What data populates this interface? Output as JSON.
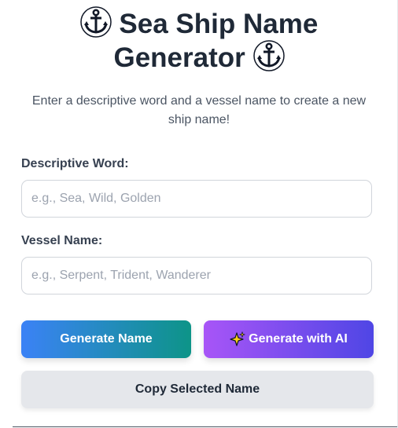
{
  "header": {
    "title_line1": "Sea Ship Name",
    "title_line2": "Generator",
    "title_icon": "anchor-icon",
    "subtitle": "Enter a descriptive word and a vessel name to create a new ship name!"
  },
  "form": {
    "descriptive_label": "Descriptive Word:",
    "descriptive_placeholder": "e.g., Sea, Wild, Golden",
    "descriptive_value": "",
    "vessel_label": "Vessel Name:",
    "vessel_placeholder": "e.g., Serpent, Trident, Wanderer",
    "vessel_value": ""
  },
  "actions": {
    "generate_label": "Generate Name",
    "generate_ai_label": "Generate with AI",
    "generate_ai_icon": "sparkles-icon",
    "copy_label": "Copy Selected Name"
  },
  "colors": {
    "title": "#1f2937",
    "generate_gradient": [
      "#3b82f6",
      "#0d9488"
    ],
    "ai_gradient": [
      "#a855f7",
      "#4f46e5"
    ],
    "copy_bg": "#e5e7eb"
  }
}
